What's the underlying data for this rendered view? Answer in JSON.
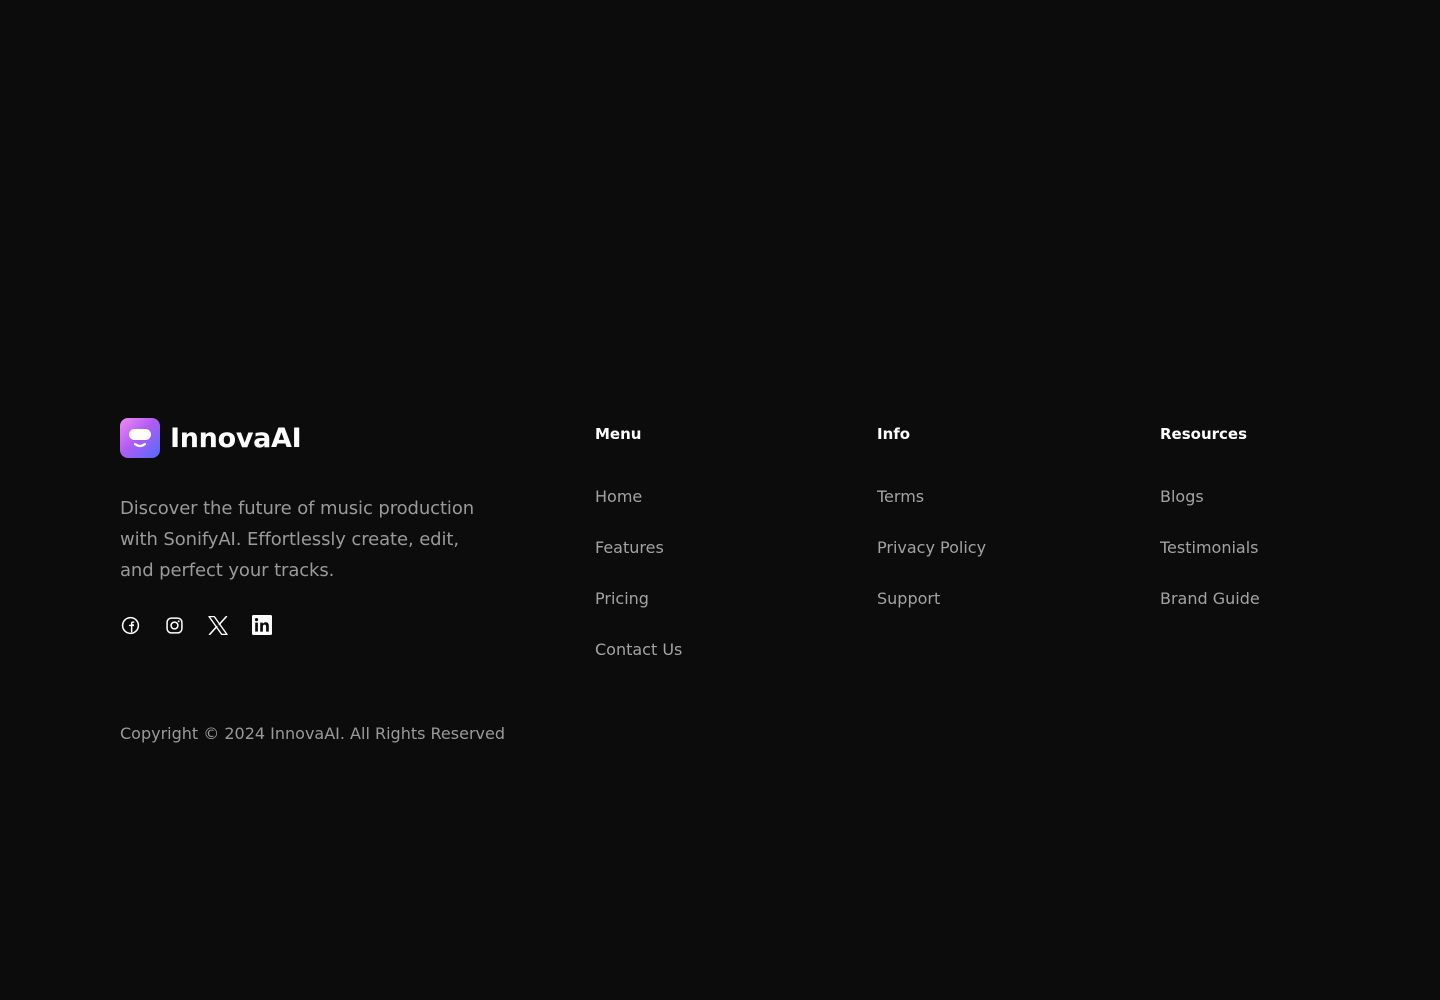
{
  "brand": {
    "name": "InnovaAI",
    "tagline": "Discover the future of music production with SonifyAI. Effortlessly create, edit, and perfect your tracks.",
    "logo_gradient": [
      "#f08cf5",
      "#b25cf2",
      "#4f6bff"
    ]
  },
  "socials": [
    {
      "icon": "facebook-icon"
    },
    {
      "icon": "instagram-icon"
    },
    {
      "icon": "x-twitter-icon"
    },
    {
      "icon": "linkedin-icon"
    }
  ],
  "columns": {
    "menu": {
      "title": "Menu",
      "links": [
        "Home",
        "Features",
        "Pricing",
        "Contact Us"
      ]
    },
    "info": {
      "title": "Info",
      "links": [
        "Terms",
        "Privacy Policy",
        "Support"
      ]
    },
    "resources": {
      "title": "Resources",
      "links": [
        "Blogs",
        "Testimonials",
        "Brand Guide"
      ]
    }
  },
  "copyright": "Copyright © 2024 InnovaAI. All Rights Reserved",
  "colors": {
    "background": "#0c0c0c",
    "heading": "#ffffff",
    "muted_text": "#9a9a9a"
  }
}
